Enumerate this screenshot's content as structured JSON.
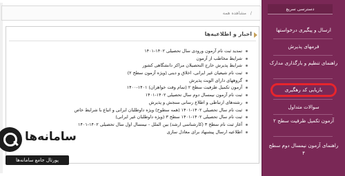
{
  "sidebar": {
    "header": "دسترسی سریع",
    "items": [
      {
        "label": "ارسال و پیگیری درخواستها"
      },
      {
        "label": "فرمهای پذیرش"
      },
      {
        "label": "راهنمای تنظیم و بارگذاری مدارک"
      },
      {
        "label": "بازیابی کد رهگیری"
      },
      {
        "label": "سوالات متداول"
      },
      {
        "label": "آزمون تکمیل ظرفیت سطح ۲"
      },
      {
        "label": "راهنمای آزمون نیمسال دوم سطح ۴"
      }
    ]
  },
  "breadcrumb": {
    "current": "مشاهده همه",
    "separator": "/"
  },
  "news": {
    "title": "اخبار و اطلاعیه‌ها",
    "items": [
      "تمدید ثبت نام آزمون ورودی سال تحصیلی ۱۴۰۲-۱۴۰۱",
      "شرایط مخاطب از آزمون",
      "شرایط پذیرش خارج التحصیلان مراکز دانشگاهی کشور",
      "ثبت نام شیعیان غیر ایرانی، اخلاق و دینی (ویژه آزمون سطح ۲)",
      "گروههای دارای الویت پذیرش",
      "آزمون تکمیل ظرفیت سطح ۲ (تمام وقت خواهران) ۱۴۰۱-۱۴۰۰",
      "ثبت نام آزمون نیمسال دوم سال تحصیلی ۱۴۰۲-۱۴۰۱",
      "رشته‌های ارتباطی و اطلاع رسانی سنجش و پذیرش",
      "ثبت نام سال تحصیلی ۱۴۰۲-۱۴۰۱ (همه سطوح) ویژه داوطلبان ایرانی و اتباع با شرایط خاص",
      "ثبت نام سال تحصیلی ۱۴۰۲-۱۴۰۱ سطح ۳ (ویژه داوطلبان غیر ایرانی)",
      "آغاز ثبت نام سطح ۳ (کارشناسی ارشد) بین الملل - نیمسال اول سال تحصیلی ۱۴۰۲-۱۴۰۱",
      "اطلاعیه ارسال پیشنهاد برای معادل سازی"
    ]
  },
  "logo": {
    "title": "سامانه‌ها",
    "subtitle": "پورتال جامع سامانه‌ها"
  }
}
